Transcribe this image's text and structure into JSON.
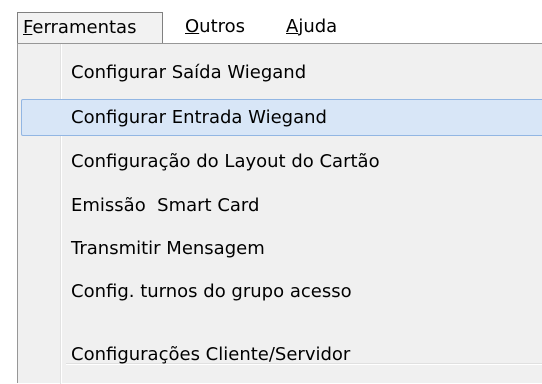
{
  "menubar": {
    "ferramentas": {
      "first": "F",
      "rest": "erramentas"
    },
    "outros": {
      "first": "O",
      "rest": "utros"
    },
    "ajuda": {
      "first": "A",
      "rest": "juda"
    }
  },
  "menu": {
    "items": [
      {
        "label": "Configurar Saída Wiegand"
      },
      {
        "label": "Configurar Entrada Wiegand"
      },
      {
        "label": "Configuração do Layout do Cartão"
      },
      {
        "label": "Emissão  Smart Card"
      },
      {
        "label": "Transmitir Mensagem"
      },
      {
        "label": "Config. turnos do grupo acesso"
      },
      {
        "label": "Configurações Cliente/Servidor"
      }
    ]
  },
  "colors": {
    "hover_bg": "#d8e6f7",
    "hover_border": "#92b6e3",
    "menu_bg": "#f0f0f0"
  }
}
